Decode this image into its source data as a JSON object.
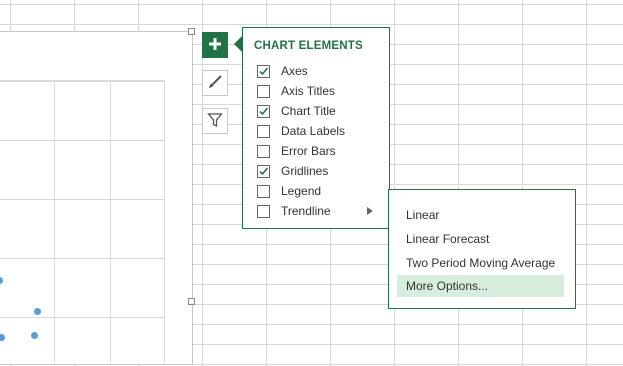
{
  "panel": {
    "title": "CHART ELEMENTS",
    "items": [
      {
        "label": "Axes",
        "checked": true
      },
      {
        "label": "Axis Titles",
        "checked": false
      },
      {
        "label": "Chart Title",
        "checked": true
      },
      {
        "label": "Data Labels",
        "checked": false
      },
      {
        "label": "Error Bars",
        "checked": false
      },
      {
        "label": "Gridlines",
        "checked": true
      },
      {
        "label": "Legend",
        "checked": false
      },
      {
        "label": "Trendline",
        "checked": false,
        "has_submenu": true
      }
    ]
  },
  "submenu": {
    "items": [
      {
        "label": "Linear"
      },
      {
        "label": "Linear Forecast"
      },
      {
        "label": "Two Period Moving Average"
      },
      {
        "label": "More Options...",
        "highlighted": true
      }
    ]
  },
  "side_buttons": [
    {
      "icon": "plus-icon",
      "active": true
    },
    {
      "icon": "brush-icon",
      "active": false
    },
    {
      "icon": "filter-icon",
      "active": false
    }
  ],
  "colors": {
    "accent": "#217346",
    "highlight": "#d7eedd",
    "data_point": "#5b9bd5"
  }
}
